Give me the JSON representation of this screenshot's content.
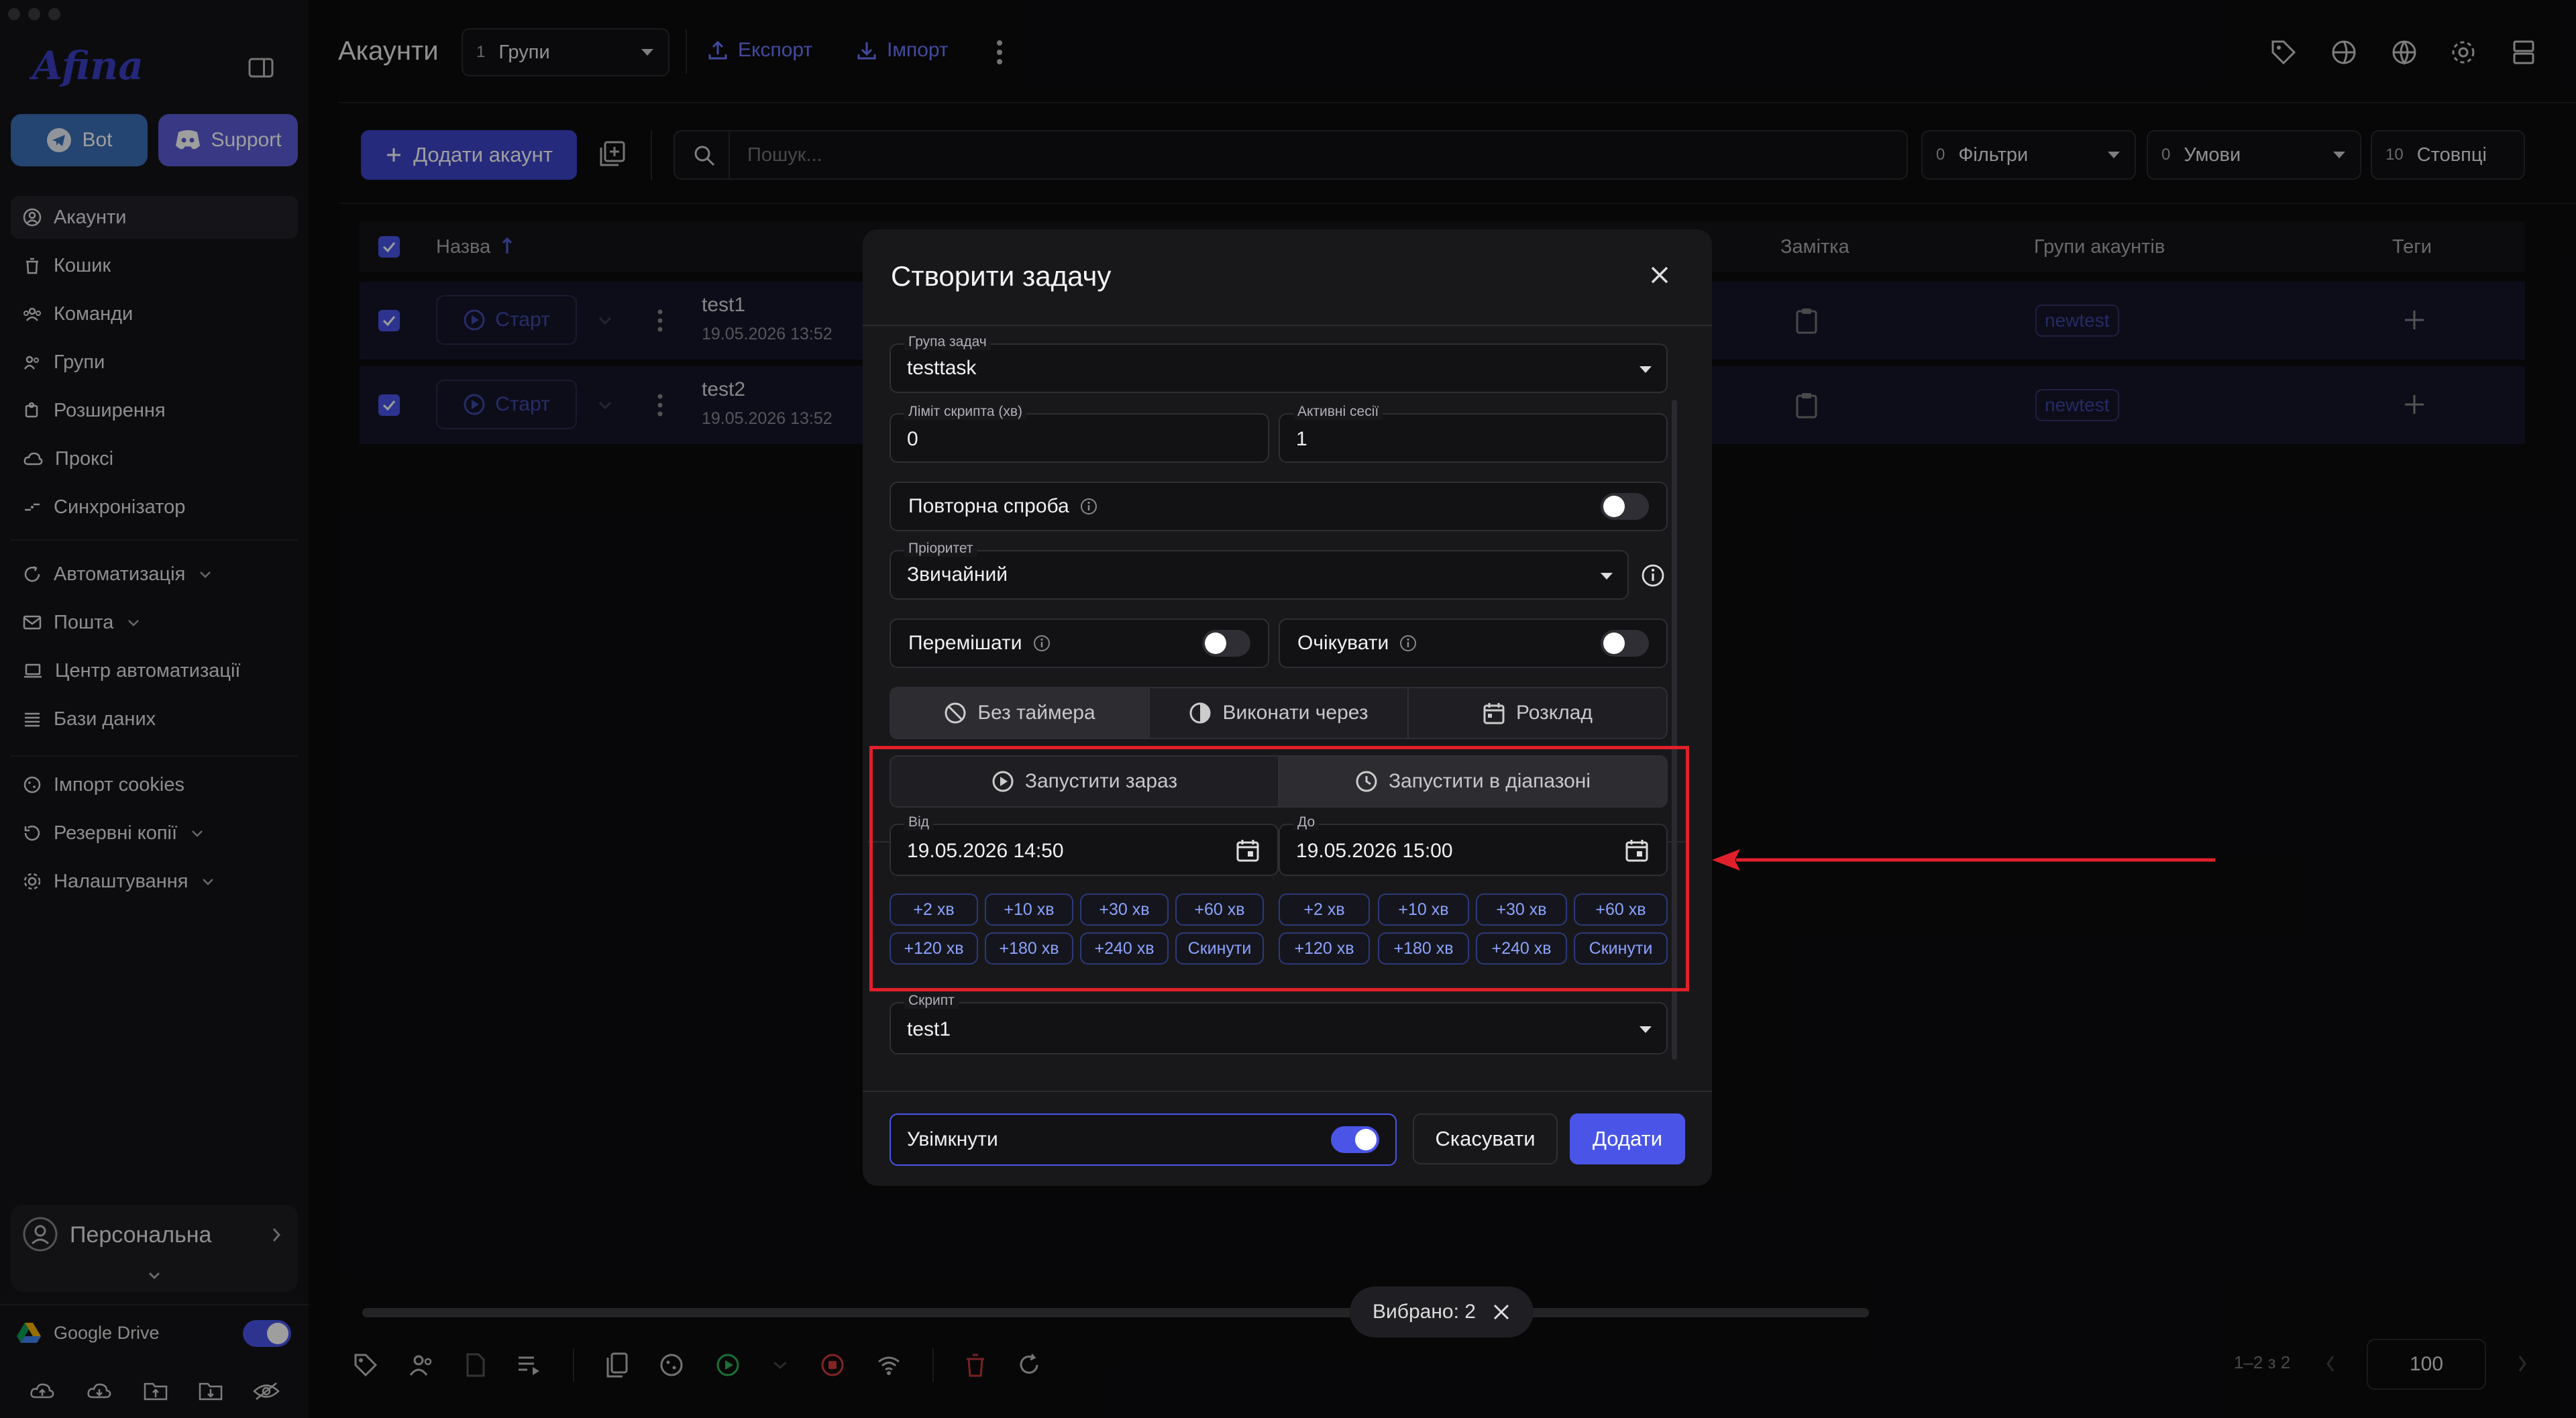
{
  "sidebar": {
    "logo": "Afina",
    "bot_label": "Bot",
    "support_label": "Support",
    "items": [
      {
        "label": "Акаунти",
        "icon": "user-circle-icon"
      },
      {
        "label": "Кошик",
        "icon": "trash-icon"
      },
      {
        "label": "Команди",
        "icon": "team-icon"
      },
      {
        "label": "Групи",
        "icon": "group-icon"
      },
      {
        "label": "Розширення",
        "icon": "puzzle-icon"
      },
      {
        "label": "Проксі",
        "icon": "cloud-icon"
      },
      {
        "label": "Синхронізатор",
        "icon": "sync-icon"
      }
    ],
    "items2": [
      {
        "label": "Автоматизація",
        "icon": "automation-icon"
      },
      {
        "label": "Пошта",
        "icon": "mail-icon"
      },
      {
        "label": "Центр автоматизації",
        "icon": "laptop-icon"
      },
      {
        "label": "Бази даних",
        "icon": "list-icon"
      }
    ],
    "items3": [
      {
        "label": "Імпорт cookies",
        "icon": "cookie-icon"
      },
      {
        "label": "Резервні копії",
        "icon": "backup-icon"
      },
      {
        "label": "Налаштування",
        "icon": "gear-icon"
      }
    ],
    "workspace": "Персональна",
    "drive_label": "Google Drive"
  },
  "header": {
    "title": "Акаунти",
    "groups_count": "1",
    "groups_label": "Групи",
    "export_label": "Експорт",
    "import_label": "Імпорт"
  },
  "toolbar": {
    "add_account": "Додати акаунт",
    "search_placeholder": "Пошук...",
    "filters_count": "0",
    "filters_label": "Фільтри",
    "conditions_count": "0",
    "conditions_label": "Умови",
    "columns_count": "10",
    "columns_label": "Стовпці"
  },
  "table": {
    "col_name": "Назва",
    "col_note": "Замітка",
    "col_groups": "Групи акаунтів",
    "col_tags": "Теги",
    "rows": [
      {
        "start": "Старт",
        "name": "test1",
        "date": "19.05.2026 13:52",
        "tag": "newtest"
      },
      {
        "start": "Старт",
        "name": "test2",
        "date": "19.05.2026 13:52",
        "tag": "newtest"
      }
    ]
  },
  "bottom": {
    "selected": "Вибрано: 2",
    "range": "1–2 з 2",
    "page_size": "100"
  },
  "modal": {
    "title": "Створити задачу",
    "group_label": "Група задач",
    "group_value": "testtask",
    "limit_label": "Ліміт скрипта (хв)",
    "limit_value": "0",
    "sessions_label": "Активні сесії",
    "sessions_value": "1",
    "retry_label": "Повторна спроба",
    "priority_label": "Пріоритет",
    "priority_value": "Звичайний",
    "shuffle_label": "Перемішати",
    "wait_label": "Очікувати",
    "timer_tabs": [
      "Без таймера",
      "Виконати через",
      "Розклад"
    ],
    "run_tabs": [
      "Запустити зараз",
      "Запустити в діапазоні"
    ],
    "from_label": "Від",
    "from_value": "19.05.2026 14:50",
    "to_label": "До",
    "to_value": "19.05.2026 15:00",
    "chips_row1": [
      "+2 хв",
      "+10 хв",
      "+30 хв",
      "+60 хв"
    ],
    "chips_row2": [
      "+120 хв",
      "+180 хв",
      "+240 хв",
      "Скинути"
    ],
    "script_label": "Скрипт",
    "script_value": "test1",
    "enabled_label": "Увімкнути",
    "cancel_label": "Скасувати",
    "add_label": "Додати"
  },
  "colors": {
    "accent": "#4a55e8",
    "highlight": "#e0202a",
    "bot": "#3b6fb6",
    "support": "#5b5bd6"
  }
}
